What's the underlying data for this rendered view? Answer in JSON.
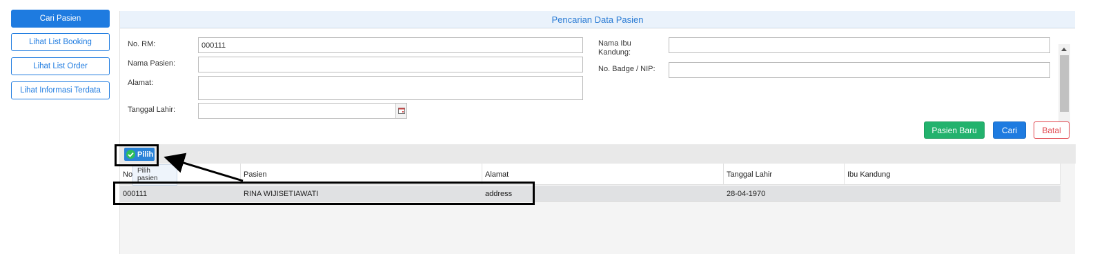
{
  "sidebar": {
    "items": [
      {
        "label": "Cari Pasien",
        "active": true
      },
      {
        "label": "Lihat List Booking",
        "active": false
      },
      {
        "label": "Lihat List Order",
        "active": false
      },
      {
        "label": "Lihat Informasi Terdata",
        "active": false
      }
    ]
  },
  "panel": {
    "title": "Pencarian Data Pasien"
  },
  "form": {
    "no_rm_label": "No. RM:",
    "no_rm_value": "000111",
    "nama_pasien_label": "Nama Pasien:",
    "nama_pasien_value": "",
    "alamat_label": "Alamat:",
    "alamat_value": "",
    "tanggal_lahir_label": "Tanggal Lahir:",
    "tanggal_lahir_value": "",
    "nama_ibu_label_line1": "Nama Ibu",
    "nama_ibu_label_line2": "Kandung:",
    "nama_ibu_value": "",
    "badge_label": "No. Badge / NIP:",
    "badge_value": ""
  },
  "actions": {
    "pasien_baru": "Pasien Baru",
    "cari": "Cari",
    "batal": "Batal"
  },
  "toolbar": {
    "pilih_label": "Pilih",
    "tooltip_line1": "Pilih",
    "tooltip_line2": "pasien"
  },
  "grid": {
    "columns": [
      "No",
      "Pasien",
      "Alamat",
      "Tanggal Lahir",
      "Ibu Kandung"
    ],
    "rows": [
      {
        "no_rm": "000111",
        "pasien": "RINA WIJISETIAWATI",
        "alamat": "address",
        "tanggal_lahir": "28-04-1970",
        "ibu_kandung": ""
      }
    ]
  },
  "colors": {
    "primary": "#1e7be0",
    "success": "#22b26d",
    "danger": "#e0424a"
  }
}
